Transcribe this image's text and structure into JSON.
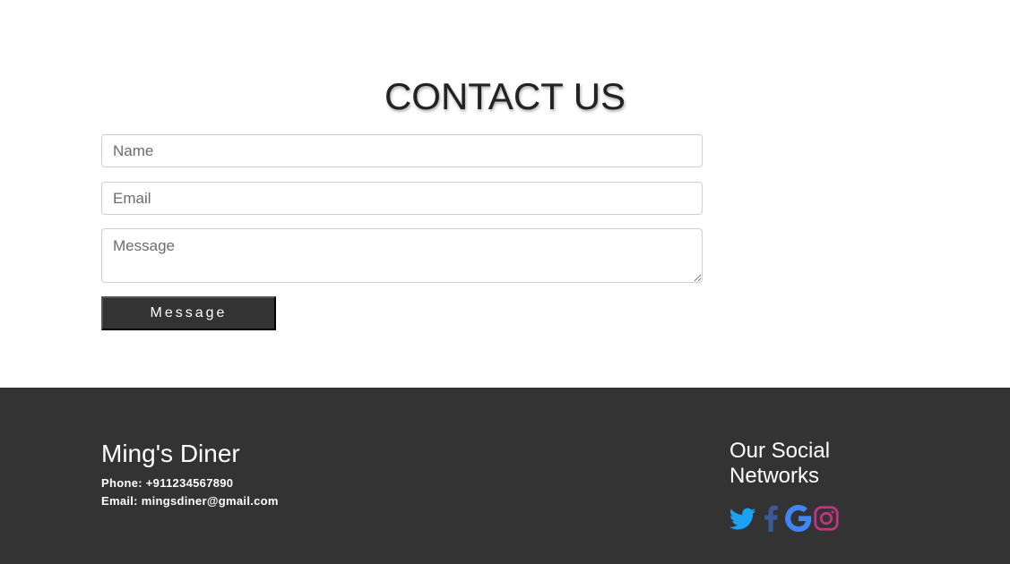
{
  "contact": {
    "title": "CONTACT US",
    "name_placeholder": "Name",
    "email_placeholder": "Email",
    "message_placeholder": "Message",
    "submit_label": "Message"
  },
  "footer": {
    "brand": "Ming's Diner",
    "phone_label": "Phone:",
    "phone_value": "+911234567890",
    "email_label": "Email:",
    "email_value": "mingsdiner@gmail.com",
    "social_title": "Our Social Networks",
    "social_icons": [
      {
        "icon": "twitter-icon",
        "color": "#1da1f2"
      },
      {
        "icon": "facebook-icon",
        "color": "#3b5998"
      },
      {
        "icon": "google-icon",
        "color": "#4285f4"
      },
      {
        "icon": "instagram-icon",
        "color": "#c13584"
      }
    ]
  },
  "colors": {
    "footer_background": "#333333",
    "button_background": "#333333"
  }
}
